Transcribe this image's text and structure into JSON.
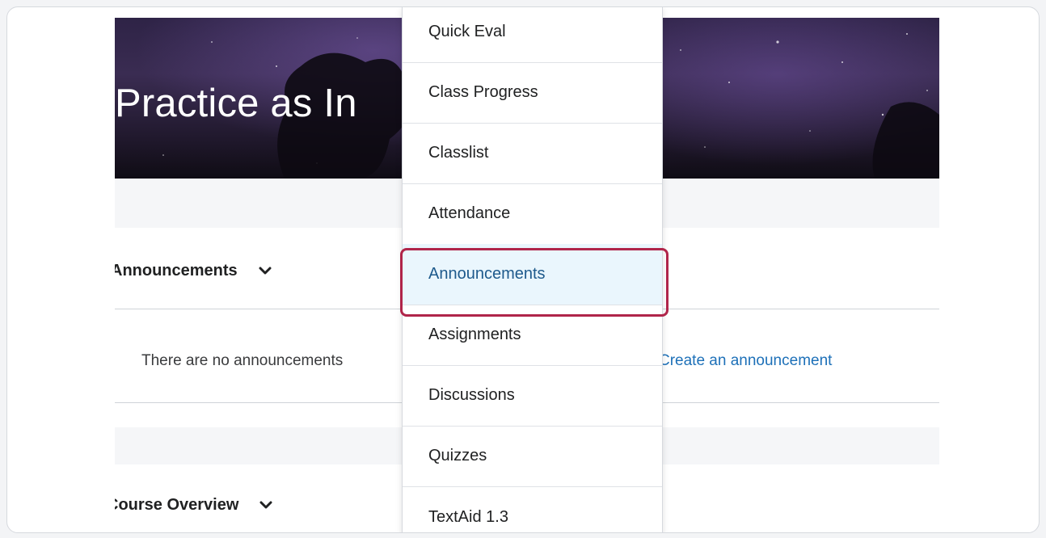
{
  "banner": {
    "title": "Practice as In"
  },
  "announcements_widget": {
    "title": "Announcements",
    "empty_text": "There are no announcements",
    "create_link": "Create an announcement"
  },
  "course_overview_widget": {
    "title": "Course Overview"
  },
  "menu": {
    "items": [
      {
        "label": "Quick Eval"
      },
      {
        "label": "Class Progress"
      },
      {
        "label": "Classlist"
      },
      {
        "label": "Attendance"
      },
      {
        "label": "Announcements",
        "selected": true
      },
      {
        "label": "Assignments"
      },
      {
        "label": "Discussions"
      },
      {
        "label": "Quizzes"
      },
      {
        "label": "TextAid 1.3"
      }
    ]
  },
  "colors": {
    "link": "#1d70b8",
    "highlight_border": "#b0254a",
    "selected_bg": "#eaf6fd"
  },
  "icons": {
    "widget_toggle": "chevron-down-icon"
  }
}
